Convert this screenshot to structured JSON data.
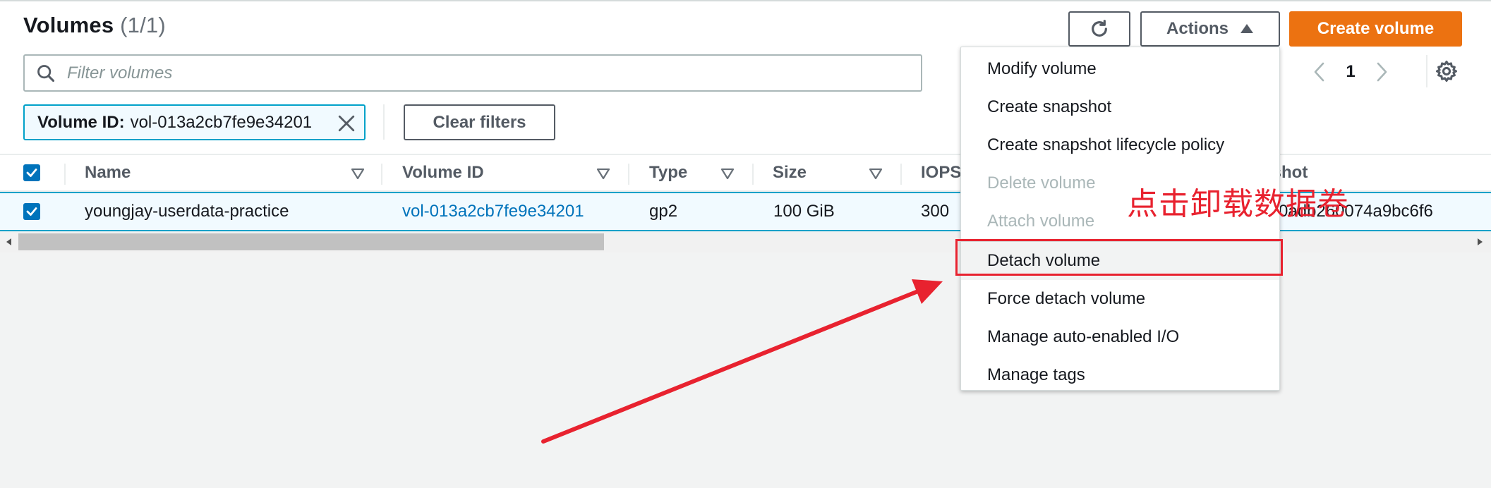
{
  "header": {
    "title": "Volumes",
    "count": "(1/1)",
    "actions_label": "Actions",
    "create_label": "Create volume"
  },
  "filter": {
    "placeholder": "Filter volumes",
    "value": ""
  },
  "pagination": {
    "page": "1"
  },
  "token": {
    "key": "Volume ID",
    "separator": ":",
    "value": "vol-013a2cb7fe9e34201"
  },
  "clear_filters_label": "Clear filters",
  "table": {
    "headers": {
      "name": "Name",
      "volume_id": "Volume ID",
      "type": "Type",
      "size": "Size",
      "iops": "IOPS",
      "snapshot": "pshot"
    },
    "rows": [
      {
        "name": "youngjay-userdata-practice",
        "volume_id": "vol-013a2cb7fe9e34201",
        "type": "gp2",
        "size": "100 GiB",
        "iops": "300",
        "snapshot": "0adb260074a9bc6f6",
        "selected": true
      }
    ]
  },
  "menu": {
    "items": [
      {
        "label": "Modify volume",
        "disabled": false
      },
      {
        "label": "Create snapshot",
        "disabled": false
      },
      {
        "label": "Create snapshot lifecycle policy",
        "disabled": false
      },
      {
        "label": "Delete volume",
        "disabled": true
      },
      {
        "label": "Attach volume",
        "disabled": true
      },
      {
        "label": "Detach volume",
        "disabled": false
      },
      {
        "label": "Force detach volume",
        "disabled": false
      },
      {
        "label": "Manage auto-enabled I/O",
        "disabled": false
      },
      {
        "label": "Manage tags",
        "disabled": false
      }
    ]
  },
  "annotation": {
    "text": "点击卸载数据卷",
    "color": "#e8222f"
  },
  "colors": {
    "primary": "#ec7211",
    "link": "#0073bb",
    "selection_border": "#00a1c9",
    "selection_bg": "#f1faff"
  }
}
